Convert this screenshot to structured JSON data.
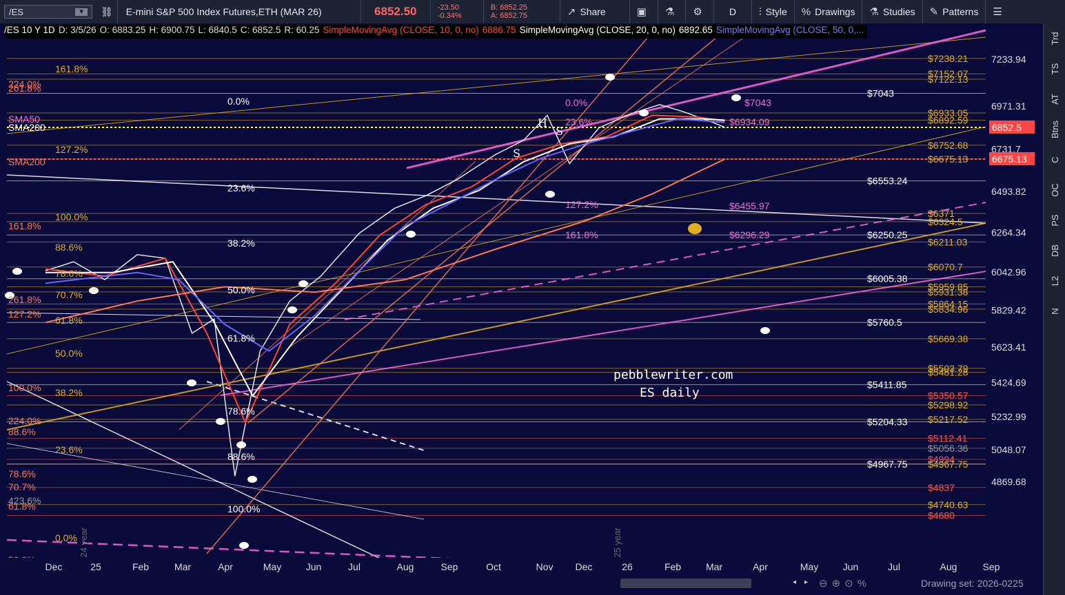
{
  "toolbar": {
    "symbol": "/ES",
    "title": "E-mini S&P 500 Index Futures,ETH (MAR 26)",
    "last_price": "6852.50",
    "change": "-23.50",
    "change_pct": "-0.34%",
    "bid": "B: 6852.25",
    "ask": "A: 6852.75",
    "share": "Share",
    "interval": "D",
    "style": "Style",
    "drawings": "Drawings",
    "studies": "Studies",
    "patterns": "Patterns"
  },
  "legend": {
    "symbol": "/ES 10 Y 1D",
    "date": "D: 3/5/26",
    "open": "O: 6883.25",
    "high": "H: 6900.75",
    "low": "L: 6840.5",
    "close": "C: 6852.5",
    "range": "R: 60.25",
    "sma10": "SimpleMovingAvg (CLOSE, 10, 0, no)",
    "sma10_val": "6886.75",
    "sma20": "SimpleMovingAvg (CLOSE, 20, 0, no)",
    "sma20_val": "6892.65",
    "sma50": "SimpleMovingAvg (CLOSE, 50, 0,..."
  },
  "right_tabs": [
    "Trd",
    "TS",
    "AT",
    "Btns",
    "C",
    "OC",
    "PS",
    "DB",
    "L2",
    "N"
  ],
  "colors": {
    "background": "#0a0a3a",
    "white": "#ffffff",
    "gold": "#e0b020",
    "magenta": "#ff66dd",
    "red": "#ff5544",
    "salmon": "#ff8866",
    "blue": "#6666ff"
  },
  "chart_data": {
    "type": "line",
    "x_ticks": [
      "Dec",
      "25",
      "Feb",
      "Mar",
      "Apr",
      "May",
      "Jun",
      "Jul",
      "Aug",
      "Sep",
      "Oct",
      "Nov",
      "Dec",
      "26",
      "Feb",
      "Mar",
      "Apr",
      "May",
      "Jun",
      "Jul",
      "Aug",
      "Sep"
    ],
    "year_labels": [
      "2024 year",
      "2025 year"
    ],
    "y_ticks": [
      7233.94,
      6971.31,
      6731.7,
      6493.82,
      6264.34,
      6042.96,
      5829.42,
      5623.41,
      5424.69,
      5232.99,
      5048.07,
      4869.68
    ],
    "price_badges": [
      {
        "label": "6852.5",
        "value": 6852.5,
        "color": "#ff4444"
      },
      {
        "label": "6675.13",
        "value": 6675.13,
        "color": "#ff4444"
      }
    ],
    "series": [
      {
        "name": "Price",
        "color": "#e6e6e6",
        "x": [
          "2024-12-01",
          "2024-12-20",
          "2025-01-10",
          "2025-02-01",
          "2025-02-20",
          "2025-03-10",
          "2025-03-25",
          "2025-04-08",
          "2025-04-25",
          "2025-05-15",
          "2025-06-05",
          "2025-07-01",
          "2025-07-25",
          "2025-08-15",
          "2025-09-05",
          "2025-10-01",
          "2025-10-20",
          "2025-11-05",
          "2025-11-20",
          "2025-12-10",
          "2026-01-01",
          "2026-01-20",
          "2026-02-05",
          "2026-02-25",
          "2026-03-05"
        ],
        "y": [
          6050,
          6100,
          6000,
          6140,
          6120,
          5700,
          5780,
          4900,
          5600,
          5880,
          6020,
          6260,
          6400,
          6470,
          6560,
          6700,
          6780,
          6920,
          6650,
          6850,
          6930,
          6980,
          6940,
          6880,
          6852.5
        ]
      },
      {
        "name": "SMA10",
        "color": "#ff4433",
        "x": [
          "2024-12-01",
          "2025-01-10",
          "2025-02-20",
          "2025-03-20",
          "2025-04-15",
          "2025-05-15",
          "2025-06-15",
          "2025-07-15",
          "2025-08-15",
          "2025-09-15",
          "2025-10-15",
          "2025-11-15",
          "2025-12-15",
          "2026-01-15",
          "2026-02-15",
          "2026-03-05"
        ],
        "y": [
          6060,
          6020,
          6120,
          5700,
          5200,
          5750,
          5980,
          6250,
          6420,
          6520,
          6680,
          6760,
          6800,
          6920,
          6910,
          6886.75
        ]
      },
      {
        "name": "SMA20",
        "color": "#ffffff",
        "x": [
          "2024-12-01",
          "2025-01-15",
          "2025-02-25",
          "2025-03-25",
          "2025-04-20",
          "2025-05-20",
          "2025-06-20",
          "2025-07-20",
          "2025-08-20",
          "2025-09-20",
          "2025-10-20",
          "2025-11-20",
          "2025-12-20",
          "2026-01-20",
          "2026-02-20",
          "2026-03-05"
        ],
        "y": [
          6040,
          6040,
          6100,
          5760,
          5350,
          5680,
          5950,
          6220,
          6400,
          6500,
          6660,
          6760,
          6800,
          6900,
          6900,
          6892.65
        ]
      },
      {
        "name": "SMA50",
        "color": "#6666ff",
        "x": [
          "2024-12-01",
          "2025-02-01",
          "2025-03-01",
          "2025-04-01",
          "2025-05-01",
          "2025-06-01",
          "2025-07-01",
          "2025-08-01",
          "2025-09-01",
          "2025-10-01",
          "2025-11-01",
          "2025-12-01",
          "2026-01-01",
          "2026-02-01",
          "2026-03-05"
        ],
        "y": [
          5980,
          6040,
          6000,
          5750,
          5600,
          5800,
          6050,
          6300,
          6430,
          6560,
          6680,
          6760,
          6830,
          6900,
          6880
        ]
      },
      {
        "name": "SMA200",
        "color": "#ff7755",
        "x": [
          "2024-12-01",
          "2025-02-01",
          "2025-04-01",
          "2025-06-01",
          "2025-08-01",
          "2025-10-01",
          "2025-12-01",
          "2026-01-15",
          "2026-03-05"
        ],
        "y": [
          5760,
          5880,
          5960,
          5930,
          6000,
          6170,
          6330,
          6480,
          6675.13
        ]
      }
    ],
    "right_level_labels": [
      {
        "label": "$7238.21",
        "value": 7238.21,
        "color": "#e0b020"
      },
      {
        "label": "$7152.07",
        "value": 7152.07,
        "color": "#e0b020"
      },
      {
        "label": "$7122.13",
        "value": 7122.13,
        "color": "#e0b020"
      },
      {
        "label": "$7043",
        "value": 7043,
        "color": "#ffffff"
      },
      {
        "label": "$6933.05",
        "value": 6933.05,
        "color": "#e0b020"
      },
      {
        "label": "$6892.59",
        "value": 6892.59,
        "color": "#e0b020"
      },
      {
        "label": "$6752.68",
        "value": 6752.68,
        "color": "#e0b020"
      },
      {
        "label": "$6675.13",
        "value": 6675.13,
        "color": "#e0b020"
      },
      {
        "label": "$6553.24",
        "value": 6553.24,
        "color": "#ffffff"
      },
      {
        "label": "$6371",
        "value": 6371,
        "color": "#e0b020"
      },
      {
        "label": "$6324.5",
        "value": 6324.5,
        "color": "#e0b020"
      },
      {
        "label": "$6250.25",
        "value": 6250.25,
        "color": "#ffffff"
      },
      {
        "label": "$6211.03",
        "value": 6211.03,
        "color": "#e0b020"
      },
      {
        "label": "$6070.7",
        "value": 6070.7,
        "color": "#e0b020"
      },
      {
        "label": "$6005.38",
        "value": 6005.38,
        "color": "#ffffff"
      },
      {
        "label": "$5959.85",
        "value": 5959.85,
        "color": "#e0b020"
      },
      {
        "label": "$5931.38",
        "value": 5931.38,
        "color": "#e0b020"
      },
      {
        "label": "$5864.15",
        "value": 5864.15,
        "color": "#e0b020"
      },
      {
        "label": "$5834.96",
        "value": 5834.96,
        "color": "#e0b020"
      },
      {
        "label": "$5760.5",
        "value": 5760.5,
        "color": "#ffffff"
      },
      {
        "label": "$5669.38",
        "value": 5669.38,
        "color": "#e0b020"
      },
      {
        "label": "$5503.79",
        "value": 5503.79,
        "color": "#e0b020"
      },
      {
        "label": "$5481.28",
        "value": 5481.28,
        "color": "#e0b020"
      },
      {
        "label": "$5411.85",
        "value": 5411.85,
        "color": "#ffffff"
      },
      {
        "label": "$5350.57",
        "value": 5350.57,
        "color": "#ff5544"
      },
      {
        "label": "$5298.92",
        "value": 5298.92,
        "color": "#e0b020"
      },
      {
        "label": "$5217.52",
        "value": 5217.52,
        "color": "#e0b020"
      },
      {
        "label": "$5204.33",
        "value": 5204.33,
        "color": "#ffffff"
      },
      {
        "label": "$5112.41",
        "value": 5112.41,
        "color": "#ff5544"
      },
      {
        "label": "$5056.36",
        "value": 5056.36,
        "color": "#999999"
      },
      {
        "label": "$4994",
        "value": 4994,
        "color": "#ff5544"
      },
      {
        "label": "$4967.75",
        "value": 4967.75,
        "color": "#ffffff"
      },
      {
        "label": "$4967.75",
        "value": 4967.75,
        "color": "#e0b020"
      },
      {
        "label": "$4837",
        "value": 4837,
        "color": "#ff5544"
      },
      {
        "label": "$4740.63",
        "value": 4740.63,
        "color": "#e0b020"
      },
      {
        "label": "$4680",
        "value": 4680,
        "color": "#ff5544"
      }
    ],
    "magenta_fib_labels": [
      {
        "label": "$7043",
        "value": 7043
      },
      {
        "label": "$6934.09",
        "value": 6934.09
      },
      {
        "label": "$6455.97",
        "value": 6455.97
      },
      {
        "label": "$6296.29",
        "value": 6296.29
      }
    ],
    "fib_labels_left": [
      "161.8%",
      "224.0%",
      "261.8%",
      "SMA50",
      "SMA200",
      "127.2%",
      "SMA200",
      "100.0%",
      "161.8%",
      "88.6%",
      "78.6%",
      "261.8%",
      "70.7%",
      "127.2%",
      "61.8%",
      "50.0%",
      "100.0%",
      "38.2%",
      "224.0%",
      "88.6%",
      "23.6%",
      "78.6%",
      "70.7%",
      "423.6%",
      "61.8%",
      "0.0%",
      "50.0%",
      "161.8%",
      "38.2%"
    ],
    "fib_labels_mid": [
      "0.0%",
      "23.6%",
      "38.2%",
      "50.0%",
      "61.8%",
      "78.6%",
      "88.6%",
      "100.0%"
    ],
    "fib_labels_top": [
      "0.0%",
      "23.6%",
      "127.2%",
      "161.8%"
    ],
    "annotations": [
      "H",
      "S",
      "S"
    ],
    "watermark": [
      "pebblewriter.com",
      "ES daily"
    ]
  },
  "bottom": {
    "drawing_set": "Drawing set: 2026-0225"
  }
}
